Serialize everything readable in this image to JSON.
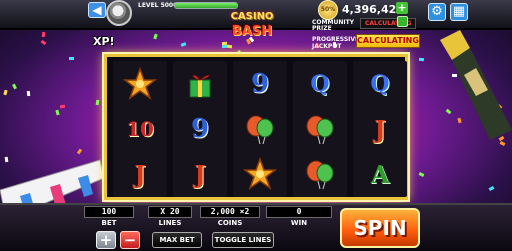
{
  "header": {
    "back_icon": "arrow-left-icon",
    "level_label": "LEVEL 5000",
    "xp_progress": 1.0,
    "xp_label": "XP!",
    "logo_line1": "CASINO",
    "logo_line2": "BASH",
    "coin_badge": "50%",
    "coin_balance": "4,396,423",
    "community_prize_label": "COMMUNITY PRIZE",
    "community_prize_value": "CALCULATING",
    "progressive_jackpot_label": "PROGRESSIVE JACKPOT",
    "progressive_jackpot_value": "CALCULATING",
    "settings_icon": "gear-icon",
    "menu_icon": "grid-icon"
  },
  "reels": [
    [
      {
        "kind": "star"
      },
      {
        "kind": "text",
        "text": "10",
        "cls": "k10"
      },
      {
        "kind": "text",
        "text": "J",
        "cls": "kj"
      }
    ],
    [
      {
        "kind": "gift"
      },
      {
        "kind": "text",
        "text": "9",
        "cls": "k9"
      },
      {
        "kind": "text",
        "text": "J",
        "cls": "kj"
      }
    ],
    [
      {
        "kind": "text",
        "text": "9",
        "cls": "k9"
      },
      {
        "kind": "balloon"
      },
      {
        "kind": "star"
      }
    ],
    [
      {
        "kind": "text",
        "text": "Q",
        "cls": "kq"
      },
      {
        "kind": "balloon"
      },
      {
        "kind": "balloon"
      }
    ],
    [
      {
        "kind": "text",
        "text": "Q",
        "cls": "kq"
      },
      {
        "kind": "text",
        "text": "J",
        "cls": "kj"
      },
      {
        "kind": "text",
        "text": "A",
        "cls": "ka"
      }
    ]
  ],
  "controls": {
    "bet_value": "100",
    "bet_label": "BET",
    "lines_value": "X 20",
    "lines_label": "LINES",
    "coins_value": "2,000 ×2",
    "coins_label": "COINS",
    "win_value": "0",
    "win_label": "WIN",
    "plus_label": "+",
    "minus_label": "−",
    "max_bet_label": "MAX BET",
    "toggle_lines_label": "TOGGLE LINES",
    "spin_label": "SPIN"
  },
  "colors": {
    "frame": "#e8c43a",
    "spin": "#ff5a0c",
    "plus_btn": "#9aa3ad",
    "minus_btn": "#e23b3b"
  }
}
